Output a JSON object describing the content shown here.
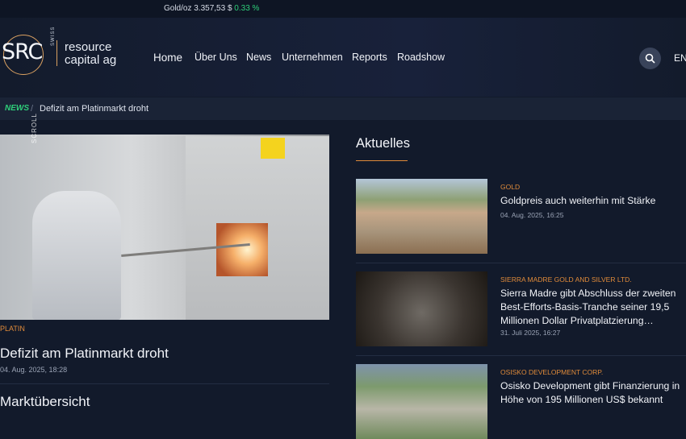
{
  "ticker": {
    "label": "Gold/oz 3.357,53 $",
    "change": "0.33 %"
  },
  "logo": {
    "initials": "SRC",
    "swiss": "SWISS",
    "line1": "resource",
    "line2": "capital ag"
  },
  "nav": {
    "items": [
      "Home",
      "Über Uns",
      "News",
      "Unternehmen",
      "Reports",
      "Roadshow"
    ]
  },
  "lang": "EN",
  "breadcrumb": {
    "section": "NEWS",
    "separator": "/",
    "current": "Defizit am Platinmarkt droht"
  },
  "hero": {
    "scroll_label": "SCROLL",
    "category": "PLATIN",
    "title": "Defizit am Platinmarkt droht",
    "date": "04. Aug. 2025, 18:28"
  },
  "market_overview": "Marktübersicht",
  "aktuelles": {
    "title": "Aktuelles",
    "articles": [
      {
        "category": "GOLD",
        "title": "Goldpreis auch weiterhin mit Stärke",
        "date": "04. Aug. 2025, 16:25"
      },
      {
        "category": "SIERRA MADRE GOLD AND SILVER LTD.",
        "title": "Sierra Madre gibt Abschluss der zweiten Best-Efforts-Basis-Tranche seiner 19,5 Millionen Dollar Privatplatzierung…",
        "date": "31. Juli 2025, 16:27"
      },
      {
        "category": "OSISKO DEVELOPMENT CORP.",
        "title": "Osisko Development gibt Finanzierung in Höhe von 195 Millionen US$ bekannt",
        "date": ""
      }
    ]
  }
}
